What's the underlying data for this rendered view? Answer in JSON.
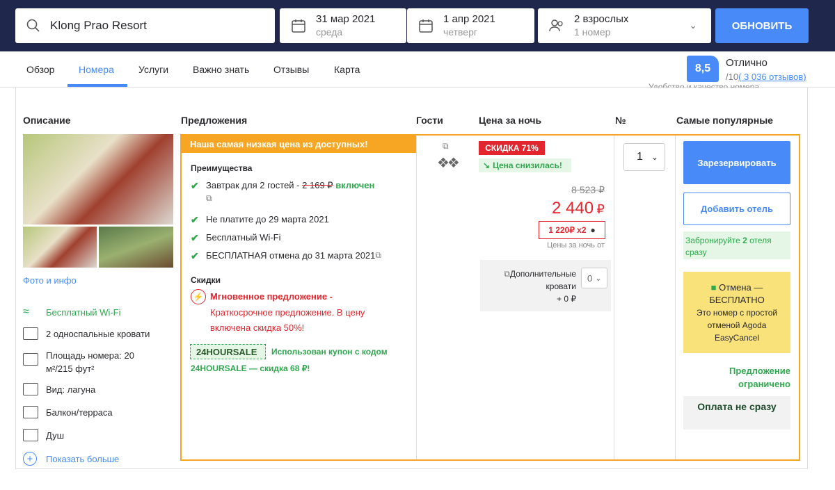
{
  "search": {
    "hotel": "Klong Prao Resort"
  },
  "checkin": {
    "date": "31 мар 2021",
    "day": "среда"
  },
  "checkout": {
    "date": "1 апр 2021",
    "day": "четверг"
  },
  "guests": {
    "adults": "2 взрослых",
    "rooms": "1 номер"
  },
  "update_label": "ОБНОВИТЬ",
  "tabs": [
    "Обзор",
    "Номера",
    "Услуги",
    "Важно знать",
    "Отзывы",
    "Карта"
  ],
  "rating": {
    "score": "8,5",
    "label": "Отлично",
    "scale": "/10",
    "reviews": "( 3 036 отзывов)",
    "cut_text": "Удобство и качество номера"
  },
  "columns": {
    "desc": "Описание",
    "offers": "Предложения",
    "guests": "Гости",
    "price": "Цена за ночь",
    "num": "№",
    "popular": "Самые популярные"
  },
  "photos_link": "Фото и инфо",
  "amenities": [
    "Бесплатный Wi-Fi",
    "2 односпальные кровати",
    "Площадь номера: 20",
    "м²/215 фут²",
    "Вид: лагуна",
    "Балкон/терраса",
    "Душ",
    "Показать больше"
  ],
  "offer": {
    "banner": "Наша самая низкая цена из доступных!",
    "benefits_title": "Преимущества",
    "breakfast": "Завтрак для 2 гостей -",
    "breakfast_price": "2 169 ₽",
    "breakfast_incl": "включен",
    "pay_later": "Не платите до 29 марта 2021",
    "wifi": "Бесплатный Wi-Fi",
    "cancel": "БЕСПЛАТНАЯ отмена до 31 марта 2021",
    "discounts_title": "Скидки",
    "instant": "Мгновенное предложение -",
    "instant_desc1": "Краткосрочное предложение. В цену",
    "instant_desc2": "включена скидка 50%!",
    "coupon_code": "24HOURSALE",
    "coupon_text1": "Использован купон с кодом",
    "coupon_text2": "24HOURSALE — скидка 68 ₽!"
  },
  "price": {
    "discount": "СКИДКА 71%",
    "dropped": "Цена снизилась!",
    "old": "8 523 ₽",
    "new": "2 440",
    "cur": "₽",
    "split": "1 220₽ x2",
    "per_night": "Цены за ночь от",
    "extra_bed1": "Дополнительные",
    "extra_bed2": "кровати",
    "extra_price": "+ 0 ₽",
    "extra_qty": "0"
  },
  "qty": "1",
  "actions": {
    "book": "Зарезервировать",
    "add": "Добавить отель",
    "hint1": "Забронируйте",
    "hint_num": "2",
    "hint2": "отеля",
    "hint3": "сразу",
    "cancel1": "Отмена —",
    "cancel2": "БЕСПЛАТНО",
    "cancel3": "Это номер с простой",
    "cancel4": "отменой Agoda",
    "cancel5": "EasyCancel",
    "limited1": "Предложение",
    "limited2": "ограничено",
    "pay": "Оплата не сразу"
  }
}
